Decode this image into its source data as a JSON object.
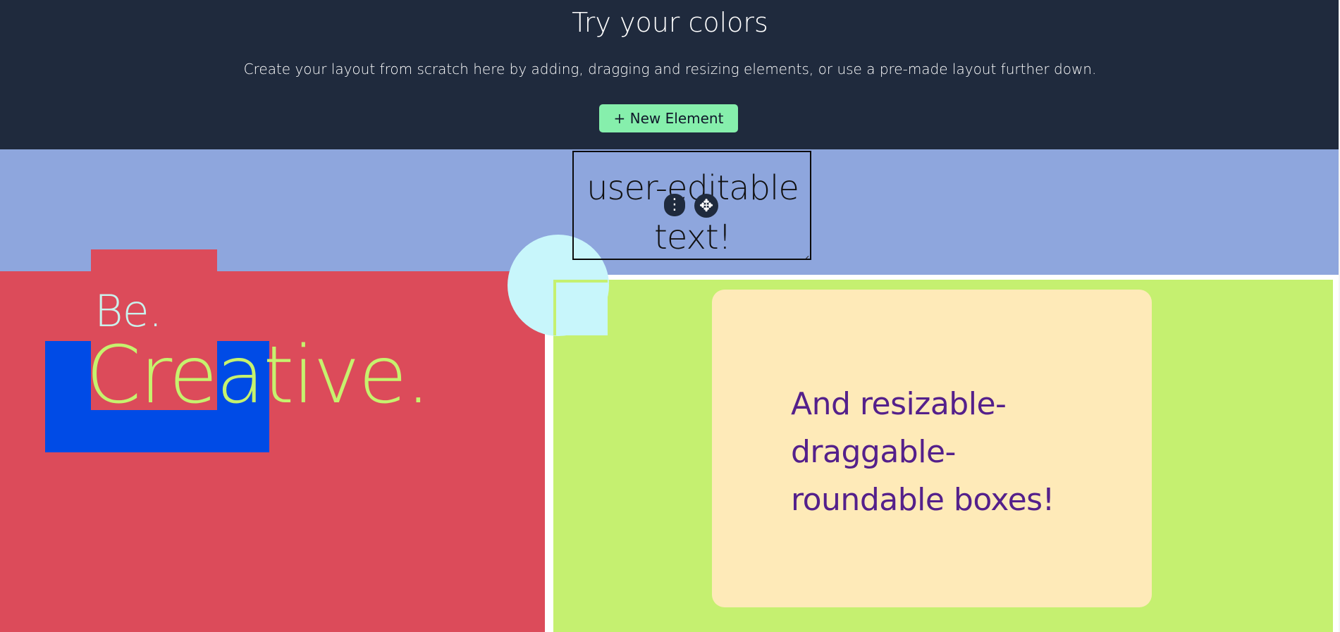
{
  "header": {
    "title": "Try your colors",
    "subtitle": "Create your layout from scratch here by adding, dragging and resizing elements, or use a pre-made layout further down.",
    "new_element_label": "+ New Element"
  },
  "canvas": {
    "editable_text": "user-editable text!",
    "headline_small": "Be.",
    "headline_large": "Creative.",
    "box_text": "And resizable-draggable-roundable boxes!",
    "menu_icon": "⋮",
    "move_icon": "✥"
  },
  "colors": {
    "header_bg": "#1f2a3d",
    "button_bg": "#86efac",
    "band_blue": "#8ea6dd",
    "red": "#dc4b5a",
    "blue_block": "#004be6",
    "lime": "#c5f070",
    "cyan": "#c8f6fb",
    "cream": "#feeab8",
    "purple_text": "#54208b"
  },
  "icons": {
    "element_menu": "dots-vertical-icon",
    "element_move": "move-arrows-icon",
    "resize_handle": "resize-handle-icon"
  }
}
